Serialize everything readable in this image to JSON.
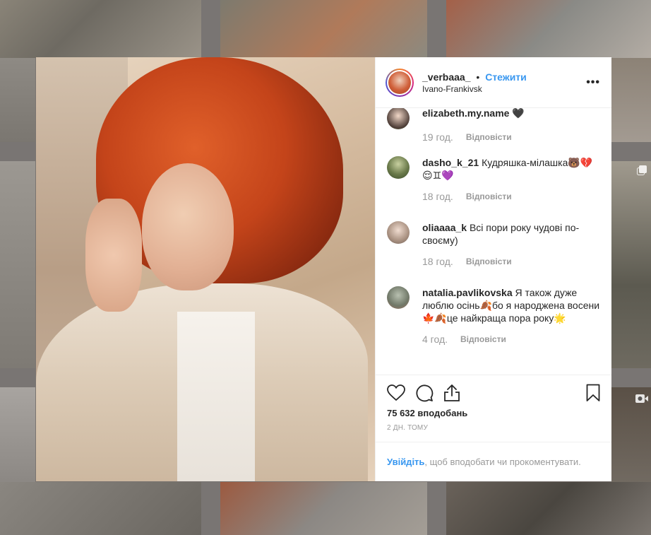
{
  "post": {
    "username": "_verbaaa_",
    "separator": "•",
    "follow_label": "Стежити",
    "location": "Ivano-Frankivsk",
    "more_label": "•••"
  },
  "comments": [
    {
      "user": "elizabeth.my.name",
      "text": "🖤",
      "time": "19 год.",
      "reply": "Відповісти"
    },
    {
      "user": "dasho_k_21",
      "text": "Кудряшка-мілашка🐻💔😌♊💜",
      "time": "18 год.",
      "reply": "Відповісти"
    },
    {
      "user": "oliaaaa_k",
      "text": "Всі пори року чудові по-своєму)",
      "time": "18 год.",
      "reply": "Відповісти"
    },
    {
      "user": "natalia.pavlikovska",
      "text": "Я також дуже люблю осінь🍂бо я народжена восени🍁🍂це найкраща пора року🌟",
      "time": "4 год.",
      "reply": "Відповісти"
    }
  ],
  "stats": {
    "likes": "75 632 вподобань",
    "date": "2 ДН. ТОМУ"
  },
  "login_prompt": {
    "link": "Увійдіть",
    "rest": ", щоб вподобати чи прокоментувати."
  },
  "icons": [
    "heart-icon",
    "comment-icon",
    "share-icon",
    "bookmark-icon",
    "more-icon",
    "video-icon",
    "carousel-icon"
  ],
  "colors": {
    "link": "#3897f0",
    "text": "#262626",
    "muted": "#999999"
  }
}
